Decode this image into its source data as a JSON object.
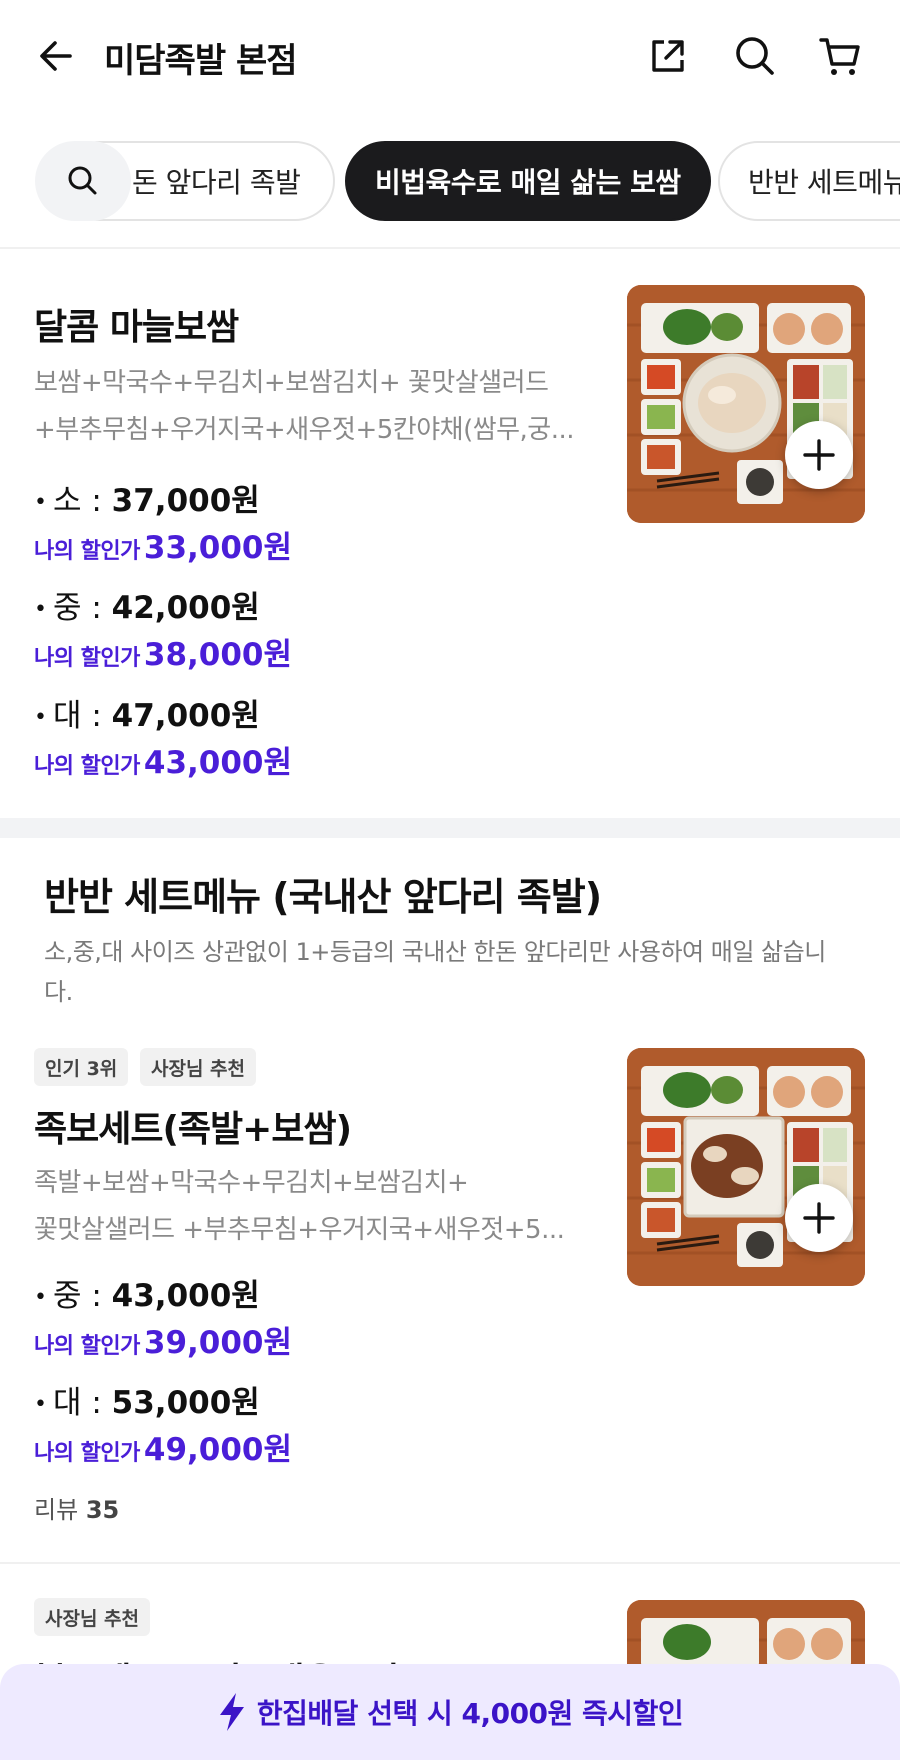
{
  "header": {
    "title": "미담족발 본점",
    "icons": [
      "back-arrow-icon",
      "share-icon",
      "search-icon",
      "cart-icon"
    ]
  },
  "tabs": [
    {
      "label": "한돈 앞다리 족발",
      "visible_text": "돈 앞다리 족발",
      "active": false
    },
    {
      "label": "비법육수로 매일 삶는 보쌈",
      "active": true
    },
    {
      "label": "반반 세트메뉴",
      "active": false
    }
  ],
  "menu1": {
    "name": "달콤 마늘보쌈",
    "desc_line1": "보쌈+막국수+무김치+보쌈김치+ 꽃맛살샐러드",
    "desc_line2": "+부추무침+우거지국+새우젓+5칸야채(쌈무,궁...",
    "prices": [
      {
        "size": "소 : ",
        "price": "37,000원",
        "discount_label": "나의 할인가",
        "discount_price": "33,000원"
      },
      {
        "size": "중 : ",
        "price": "42,000원",
        "discount_label": "나의 할인가",
        "discount_price": "38,000원"
      },
      {
        "size": "대 : ",
        "price": "47,000원",
        "discount_label": "나의 할인가",
        "discount_price": "43,000원"
      }
    ]
  },
  "section": {
    "title": "반반 세트메뉴 (국내산 앞다리 족발)",
    "desc": "소,중,대 사이즈 상관없이 1+등급의 국내산 한돈 앞다리만 사용하여 매일 삶습니다."
  },
  "menu2": {
    "badges": [
      "인기 3위",
      "사장님 추천"
    ],
    "name": "족보세트(족발+보쌈)",
    "desc_line1": "족발+보쌈+막국수+무김치+보쌈김치+",
    "desc_line2": "꽃맛살샐러드 +부추무침+우거지국+새우젓+5...",
    "prices": [
      {
        "size": "중 : ",
        "price": "43,000원",
        "discount_label": "나의 할인가",
        "discount_price": "39,000원"
      },
      {
        "size": "대 : ",
        "price": "53,000원",
        "discount_label": "나의 할인가",
        "discount_price": "49,000원"
      }
    ],
    "review_label": "리뷰",
    "review_count": "35"
  },
  "menu3": {
    "badges": [
      "사장님 추천"
    ],
    "name": "불족세트(족발+매운족발)"
  },
  "banner": {
    "text": "한집배달 선택 시 4,000원 즉시할인",
    "icon": "lightning-icon"
  },
  "colors": {
    "discount": "#4a1ed8",
    "active_tab": "#1b1b1d",
    "banner_bg": "#eeeaff",
    "banner_text": "#3b14c7"
  }
}
